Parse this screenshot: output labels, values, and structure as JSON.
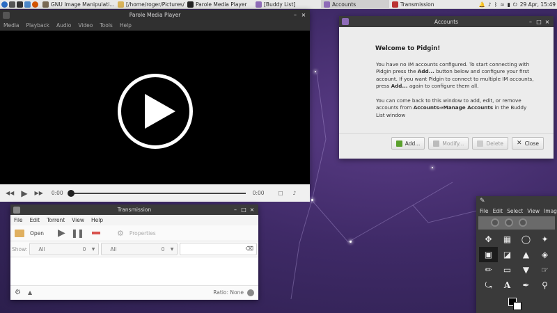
{
  "taskbar": {
    "tasks": [
      {
        "label": "GNU Image Manipulati...",
        "icon": "gimp-icon"
      },
      {
        "label": "[/home/roger/Pictures/...",
        "icon": "folder-icon"
      },
      {
        "label": "Parole Media Player",
        "icon": "parole-icon"
      },
      {
        "label": "[Buddy List]",
        "icon": "pidgin-icon"
      },
      {
        "label": "Accounts",
        "icon": "pidgin-icon"
      },
      {
        "label": "Transmission",
        "icon": "transmission-icon"
      }
    ],
    "clock": "29 Apr, 15:49"
  },
  "parole": {
    "title": "Parole Media Player",
    "menu": [
      "Media",
      "Playback",
      "Audio",
      "Video",
      "Tools",
      "Help"
    ],
    "time_elapsed": "0:00",
    "time_total": "0:00",
    "progress": 0
  },
  "accounts": {
    "title": "Accounts",
    "heading": "Welcome to Pidgin!",
    "para1_a": "You have no IM accounts configured. To start connecting with Pidgin press the ",
    "para1_b": "Add...",
    "para1_c": " button below and configure your first account. If you want Pidgin to connect to multiple IM accounts, press ",
    "para1_d": "Add...",
    "para1_e": " again to configure them all.",
    "para2_a": "You can come back to this window to add, edit, or remove accounts from ",
    "para2_b": "Accounts⇒Manage Accounts",
    "para2_c": " in the Buddy List window",
    "buttons": {
      "add": "Add...",
      "modify": "Modify...",
      "delete": "Delete",
      "close": "Close"
    }
  },
  "transmission": {
    "title": "Transmission",
    "menu": [
      "File",
      "Edit",
      "Torrent",
      "View",
      "Help"
    ],
    "open_label": "Open",
    "properties_label": "Properties",
    "show_label": "Show:",
    "filter1": {
      "value": "All",
      "count": "0"
    },
    "filter2": {
      "value": "All",
      "count": "0"
    },
    "ratio": "Ratio: None"
  },
  "gimp": {
    "menu": [
      "File",
      "Edit",
      "Select",
      "View",
      "Image"
    ]
  }
}
